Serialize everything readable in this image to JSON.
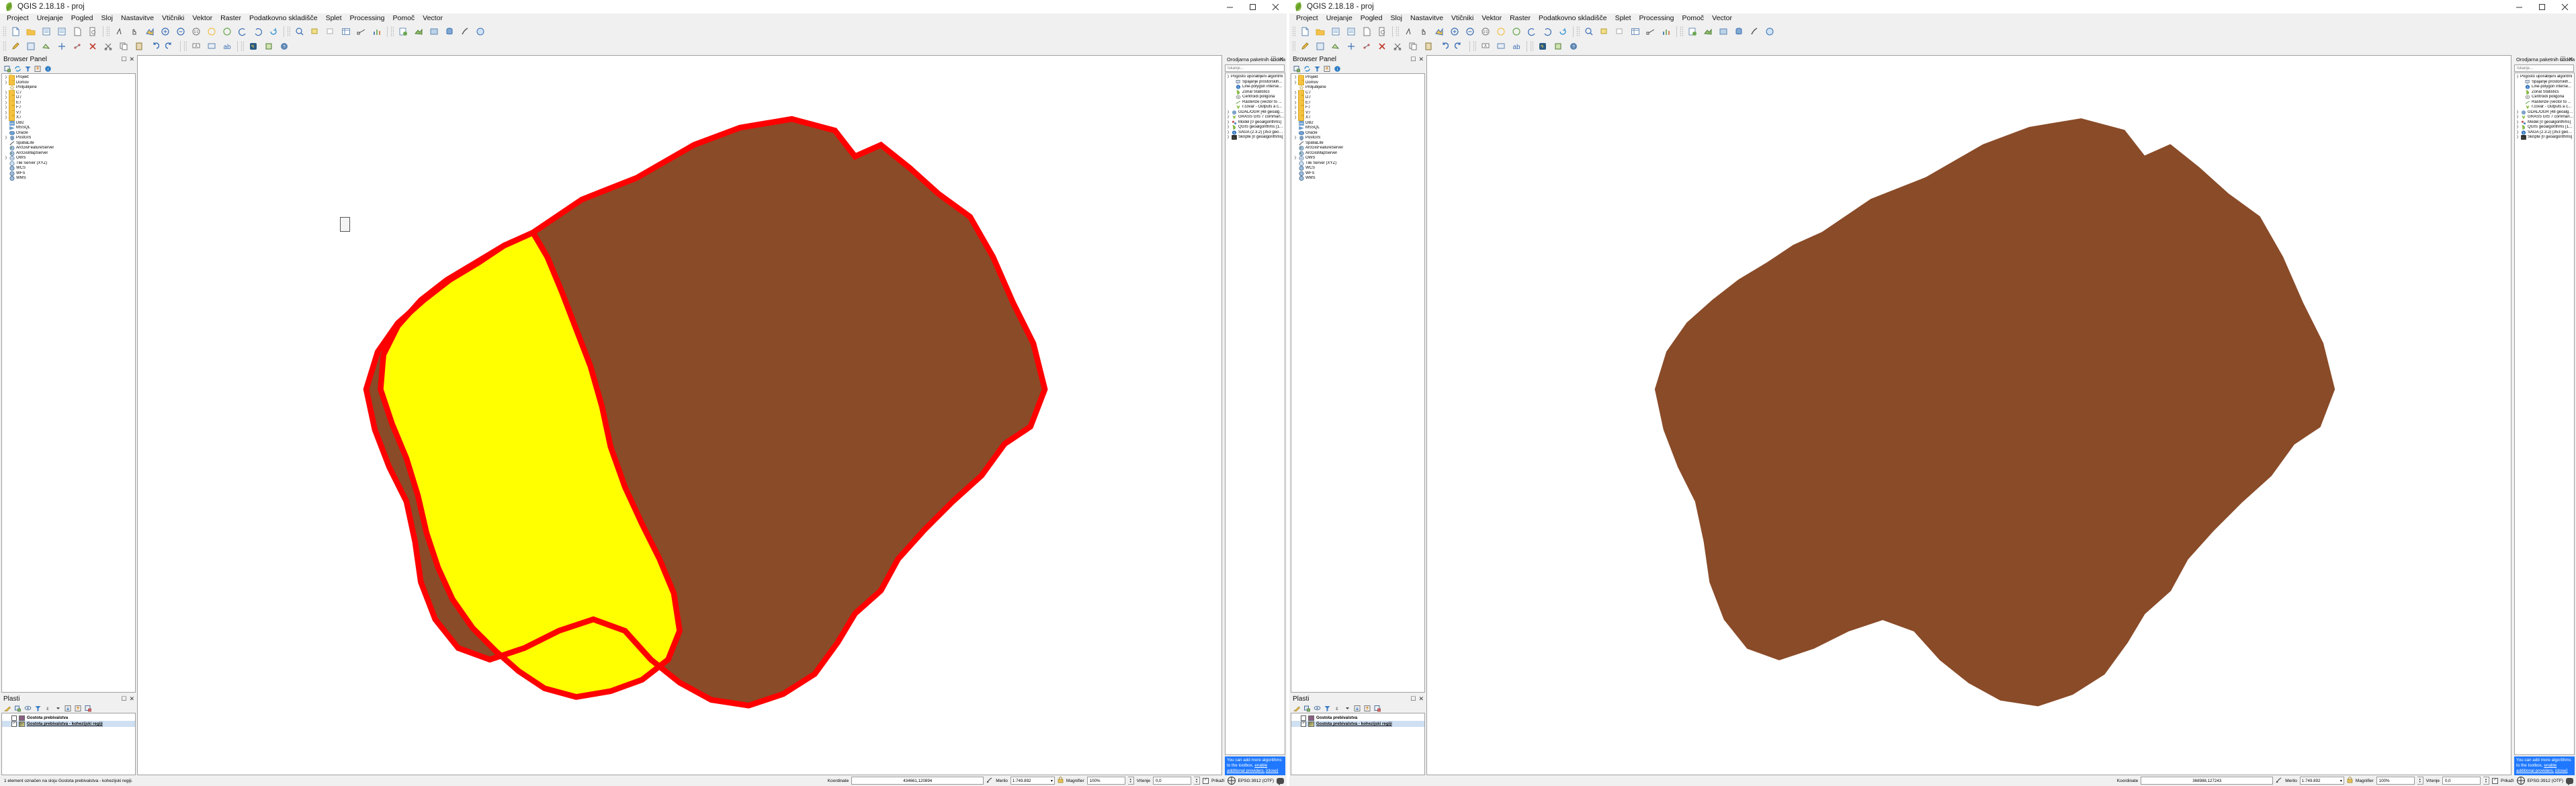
{
  "window": {
    "title": "QGIS 2.18.18 - proj",
    "controls": {
      "minimize": "minimize-icon",
      "maximize": "maximize-icon",
      "close": "close-icon"
    }
  },
  "menubar": {
    "items": [
      "Project",
      "Urejanje",
      "Pogled",
      "Sloj",
      "Nastavitve",
      "Vtičniki",
      "Vektor",
      "Raster",
      "Podatkovno skladišče",
      "Splet",
      "Processing",
      "Pomoč",
      "Vector"
    ]
  },
  "browser_panel": {
    "title": "Browser Panel",
    "toolbar": [
      "add-layer-icon",
      "refresh-icon",
      "filter-icon",
      "collapse-all-icon",
      "properties-icon"
    ],
    "items": [
      {
        "label": "Projekt",
        "icon": "folder-icon",
        "expandable": true
      },
      {
        "label": "Domov",
        "icon": "folder-icon",
        "expandable": true
      },
      {
        "label": "Prilljubljene",
        "icon": "star-icon",
        "expandable": false
      },
      {
        "label": "C:/",
        "icon": "folder-icon",
        "expandable": true
      },
      {
        "label": "D:/",
        "icon": "folder-icon",
        "expandable": true
      },
      {
        "label": "E:/",
        "icon": "folder-icon",
        "expandable": true
      },
      {
        "label": "F:/",
        "icon": "folder-icon",
        "expandable": true
      },
      {
        "label": "V:/",
        "icon": "folder-icon",
        "expandable": true
      },
      {
        "label": "X:/",
        "icon": "folder-icon",
        "expandable": true
      },
      {
        "label": "DB2",
        "icon": "db2-icon",
        "expandable": false
      },
      {
        "label": "MSSQL",
        "icon": "mssql-icon",
        "expandable": false
      },
      {
        "label": "Oracle",
        "icon": "oracle-icon",
        "expandable": false
      },
      {
        "label": "PostGIS",
        "icon": "postgis-icon",
        "expandable": true
      },
      {
        "label": "SpatiaLite",
        "icon": "spatialite-icon",
        "expandable": false
      },
      {
        "label": "ArcGisFeatureServer",
        "icon": "arcgis-icon",
        "expandable": false
      },
      {
        "label": "ArcGisMapServer",
        "icon": "arcgis-icon",
        "expandable": false
      },
      {
        "label": "OWS",
        "icon": "globe-icon",
        "expandable": true
      },
      {
        "label": "Tile Server (XYZ)",
        "icon": "globe-icon",
        "expandable": false
      },
      {
        "label": "WCS",
        "icon": "globe-icon",
        "expandable": false
      },
      {
        "label": "WFS",
        "icon": "globe-icon",
        "expandable": false
      },
      {
        "label": "WMS",
        "icon": "globe-icon",
        "expandable": false
      }
    ]
  },
  "layers_panel": {
    "title": "Plasti",
    "toolbar": [
      "style-manager-icon",
      "add-group-icon",
      "visibility-icon",
      "filter-icon",
      "expression-icon",
      "dropdown-icon",
      "expand-all-icon",
      "collapse-all-icon",
      "remove-layer-icon"
    ],
    "layers": [
      {
        "name": "Gostota prebivalstva",
        "checked": false,
        "selected": false,
        "swatch": "#8a5f82"
      },
      {
        "name": "Gostota prebivalstva - kohezijski regiji",
        "checked": true,
        "selected": true,
        "swatch": "#c8b46e"
      }
    ]
  },
  "processing_panel": {
    "title": "Orodjarna paketnih obdelav",
    "search_placeholder": "Iskanje...",
    "items": [
      {
        "label": "Pogosto uporabljeni algoritmi",
        "level": 0,
        "expanded": true,
        "icon": ""
      },
      {
        "label": "Spajanje prostorskih...",
        "level": 2,
        "icon": "join-attributes-icon"
      },
      {
        "label": "Line-polygon interse...",
        "level": 2,
        "icon": "saga-icon"
      },
      {
        "label": "Zonal Statistics",
        "level": 2,
        "icon": "qgis-icon"
      },
      {
        "label": "Centroidi poligona",
        "level": 2,
        "icon": "centroids-icon"
      },
      {
        "label": "Rasterize (vector to ...",
        "level": 2,
        "icon": "rasterize-icon"
      },
      {
        "label": "r.covar - Outputs a c...",
        "level": 2,
        "icon": "grass-icon"
      },
      {
        "label": "GDAL/OGR [48 geoalgorit...",
        "level": 0,
        "collapsed": true,
        "icon": "gdal-icon"
      },
      {
        "label": "GRASS GIS 7 commands [...",
        "level": 0,
        "collapsed": true,
        "icon": "grass-icon"
      },
      {
        "label": "Model [0 geoalgorithms]",
        "level": 0,
        "collapsed": true,
        "icon": "model-icon"
      },
      {
        "label": "QGIS geoalgorithms [117...",
        "level": 0,
        "collapsed": true,
        "icon": "qgis-icon"
      },
      {
        "label": "SAGA (2.3.2) [353 geoal...",
        "level": 0,
        "collapsed": true,
        "icon": "saga-icon"
      },
      {
        "label": "Skripte [0 geoalgorithms]",
        "level": 0,
        "collapsed": true,
        "icon": "script-icon"
      }
    ]
  },
  "map_message": {
    "text_before": "You can add more algorithms to the toolbox, ",
    "link": "enable additional providers.",
    "close": "[close]"
  },
  "statusbar": {
    "left": {
      "message": "1 element označen na sloju Gostota prebivalstva - kohezijski regiji.",
      "coordinate_label": "Koordinate",
      "coordinate_value": "434661,120894",
      "scale_label": "Merilo",
      "scale_value": "1:749.892",
      "magnifier_label": "Magnifier",
      "magnifier_value": "100%",
      "rotation_label": "Vrtenje",
      "rotation_value": "0,0",
      "render_label": "Prikaži",
      "render_checked": true,
      "crs_label": "EPSG:3912 (OTF)"
    },
    "right": {
      "message": "",
      "coordinate_label": "Koordinate",
      "coordinate_value": "368988,127243",
      "scale_label": "Merilo",
      "scale_value": "1:749.892",
      "magnifier_label": "Magnifier",
      "magnifier_value": "100%",
      "rotation_label": "Vrtenje",
      "rotation_value": "0,0",
      "render_label": "Prikaži",
      "render_checked": true,
      "crs_label": "EPSG:3912 (OTF)"
    }
  },
  "map": {
    "colors": {
      "brown": "#8a4b28",
      "yellow": "#ffff00",
      "highlight_outline": "#ff0000",
      "background": "#ffffff"
    },
    "left_view": {
      "selection_highlight": true,
      "selected_region_fill": "#ffff00"
    },
    "right_view": {
      "selection_highlight": false
    }
  }
}
